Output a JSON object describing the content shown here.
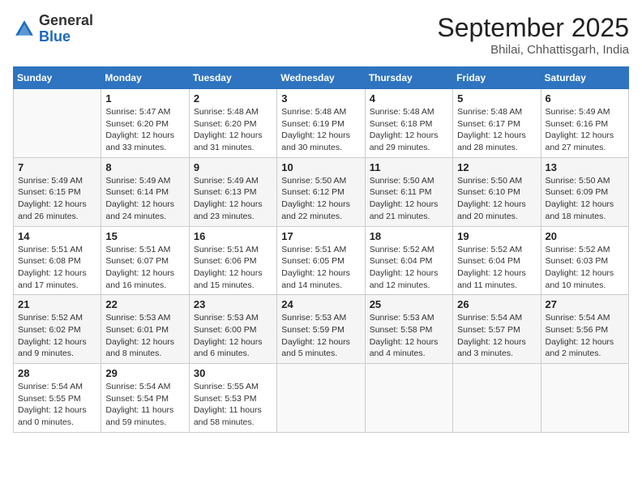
{
  "header": {
    "logo_general": "General",
    "logo_blue": "Blue",
    "month_title": "September 2025",
    "location": "Bhilai, Chhattisgarh, India"
  },
  "days_of_week": [
    "Sunday",
    "Monday",
    "Tuesday",
    "Wednesday",
    "Thursday",
    "Friday",
    "Saturday"
  ],
  "weeks": [
    [
      {
        "day": "",
        "info": ""
      },
      {
        "day": "1",
        "info": "Sunrise: 5:47 AM\nSunset: 6:20 PM\nDaylight: 12 hours\nand 33 minutes."
      },
      {
        "day": "2",
        "info": "Sunrise: 5:48 AM\nSunset: 6:20 PM\nDaylight: 12 hours\nand 31 minutes."
      },
      {
        "day": "3",
        "info": "Sunrise: 5:48 AM\nSunset: 6:19 PM\nDaylight: 12 hours\nand 30 minutes."
      },
      {
        "day": "4",
        "info": "Sunrise: 5:48 AM\nSunset: 6:18 PM\nDaylight: 12 hours\nand 29 minutes."
      },
      {
        "day": "5",
        "info": "Sunrise: 5:48 AM\nSunset: 6:17 PM\nDaylight: 12 hours\nand 28 minutes."
      },
      {
        "day": "6",
        "info": "Sunrise: 5:49 AM\nSunset: 6:16 PM\nDaylight: 12 hours\nand 27 minutes."
      }
    ],
    [
      {
        "day": "7",
        "info": "Sunrise: 5:49 AM\nSunset: 6:15 PM\nDaylight: 12 hours\nand 26 minutes."
      },
      {
        "day": "8",
        "info": "Sunrise: 5:49 AM\nSunset: 6:14 PM\nDaylight: 12 hours\nand 24 minutes."
      },
      {
        "day": "9",
        "info": "Sunrise: 5:49 AM\nSunset: 6:13 PM\nDaylight: 12 hours\nand 23 minutes."
      },
      {
        "day": "10",
        "info": "Sunrise: 5:50 AM\nSunset: 6:12 PM\nDaylight: 12 hours\nand 22 minutes."
      },
      {
        "day": "11",
        "info": "Sunrise: 5:50 AM\nSunset: 6:11 PM\nDaylight: 12 hours\nand 21 minutes."
      },
      {
        "day": "12",
        "info": "Sunrise: 5:50 AM\nSunset: 6:10 PM\nDaylight: 12 hours\nand 20 minutes."
      },
      {
        "day": "13",
        "info": "Sunrise: 5:50 AM\nSunset: 6:09 PM\nDaylight: 12 hours\nand 18 minutes."
      }
    ],
    [
      {
        "day": "14",
        "info": "Sunrise: 5:51 AM\nSunset: 6:08 PM\nDaylight: 12 hours\nand 17 minutes."
      },
      {
        "day": "15",
        "info": "Sunrise: 5:51 AM\nSunset: 6:07 PM\nDaylight: 12 hours\nand 16 minutes."
      },
      {
        "day": "16",
        "info": "Sunrise: 5:51 AM\nSunset: 6:06 PM\nDaylight: 12 hours\nand 15 minutes."
      },
      {
        "day": "17",
        "info": "Sunrise: 5:51 AM\nSunset: 6:05 PM\nDaylight: 12 hours\nand 14 minutes."
      },
      {
        "day": "18",
        "info": "Sunrise: 5:52 AM\nSunset: 6:04 PM\nDaylight: 12 hours\nand 12 minutes."
      },
      {
        "day": "19",
        "info": "Sunrise: 5:52 AM\nSunset: 6:04 PM\nDaylight: 12 hours\nand 11 minutes."
      },
      {
        "day": "20",
        "info": "Sunrise: 5:52 AM\nSunset: 6:03 PM\nDaylight: 12 hours\nand 10 minutes."
      }
    ],
    [
      {
        "day": "21",
        "info": "Sunrise: 5:52 AM\nSunset: 6:02 PM\nDaylight: 12 hours\nand 9 minutes."
      },
      {
        "day": "22",
        "info": "Sunrise: 5:53 AM\nSunset: 6:01 PM\nDaylight: 12 hours\nand 8 minutes."
      },
      {
        "day": "23",
        "info": "Sunrise: 5:53 AM\nSunset: 6:00 PM\nDaylight: 12 hours\nand 6 minutes."
      },
      {
        "day": "24",
        "info": "Sunrise: 5:53 AM\nSunset: 5:59 PM\nDaylight: 12 hours\nand 5 minutes."
      },
      {
        "day": "25",
        "info": "Sunrise: 5:53 AM\nSunset: 5:58 PM\nDaylight: 12 hours\nand 4 minutes."
      },
      {
        "day": "26",
        "info": "Sunrise: 5:54 AM\nSunset: 5:57 PM\nDaylight: 12 hours\nand 3 minutes."
      },
      {
        "day": "27",
        "info": "Sunrise: 5:54 AM\nSunset: 5:56 PM\nDaylight: 12 hours\nand 2 minutes."
      }
    ],
    [
      {
        "day": "28",
        "info": "Sunrise: 5:54 AM\nSunset: 5:55 PM\nDaylight: 12 hours\nand 0 minutes."
      },
      {
        "day": "29",
        "info": "Sunrise: 5:54 AM\nSunset: 5:54 PM\nDaylight: 11 hours\nand 59 minutes."
      },
      {
        "day": "30",
        "info": "Sunrise: 5:55 AM\nSunset: 5:53 PM\nDaylight: 11 hours\nand 58 minutes."
      },
      {
        "day": "",
        "info": ""
      },
      {
        "day": "",
        "info": ""
      },
      {
        "day": "",
        "info": ""
      },
      {
        "day": "",
        "info": ""
      }
    ]
  ]
}
